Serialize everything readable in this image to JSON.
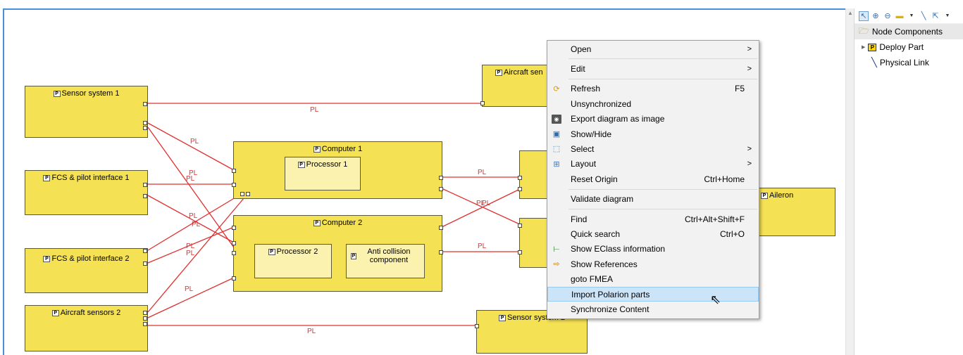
{
  "palette": {
    "group_label": "Node Components",
    "items": [
      {
        "label": "Deploy Part"
      },
      {
        "label": "Physical Link"
      }
    ]
  },
  "diagram": {
    "nodes": {
      "sensor_system_1": "Sensor system 1",
      "fcs_pilot_interface_1": "FCS & pilot interface 1",
      "fcs_pilot_interface_2": "FCS & pilot interface 2",
      "aircraft_sensors_2": "Aircraft sensors 2",
      "computer_1": "Computer 1",
      "processor_1": "Processor 1",
      "computer_2": "Computer 2",
      "processor_2": "Processor 2",
      "anti_collision": "Anti collision component",
      "aircraft_sensors_1": "Aircraft sen",
      "sensor_system_2": "Sensor system 2",
      "aileron": "Aileron"
    },
    "link_label": "PL",
    "link_color": "#e03030",
    "node_color": "#f5e154"
  },
  "context_menu": {
    "items": [
      {
        "label": "Open",
        "shortcut": "",
        "submenu": true
      },
      {
        "label": "Edit",
        "shortcut": "",
        "submenu": true
      },
      {
        "label": "Refresh",
        "shortcut": "F5",
        "submenu": false
      },
      {
        "label": "Unsynchronized",
        "shortcut": "",
        "submenu": false
      },
      {
        "label": "Export diagram as image",
        "shortcut": "",
        "submenu": false
      },
      {
        "label": "Show/Hide",
        "shortcut": "",
        "submenu": false
      },
      {
        "label": "Select",
        "shortcut": "",
        "submenu": true
      },
      {
        "label": "Layout",
        "shortcut": "",
        "submenu": true
      },
      {
        "label": "Reset Origin",
        "shortcut": "Ctrl+Home",
        "submenu": false
      },
      {
        "label": "Validate diagram",
        "shortcut": "",
        "submenu": false
      },
      {
        "label": "Find",
        "shortcut": "Ctrl+Alt+Shift+F",
        "submenu": false
      },
      {
        "label": "Quick search",
        "shortcut": "Ctrl+O",
        "submenu": false
      },
      {
        "label": "Show EClass information",
        "shortcut": "",
        "submenu": false
      },
      {
        "label": "Show References",
        "shortcut": "",
        "submenu": false
      },
      {
        "label": "goto FMEA",
        "shortcut": "",
        "submenu": false
      },
      {
        "label": "Import Polarion parts",
        "shortcut": "",
        "submenu": false,
        "highlighted": true
      },
      {
        "label": "Synchronize Content",
        "shortcut": "",
        "submenu": false
      }
    ],
    "submenu_arrow": ">"
  }
}
